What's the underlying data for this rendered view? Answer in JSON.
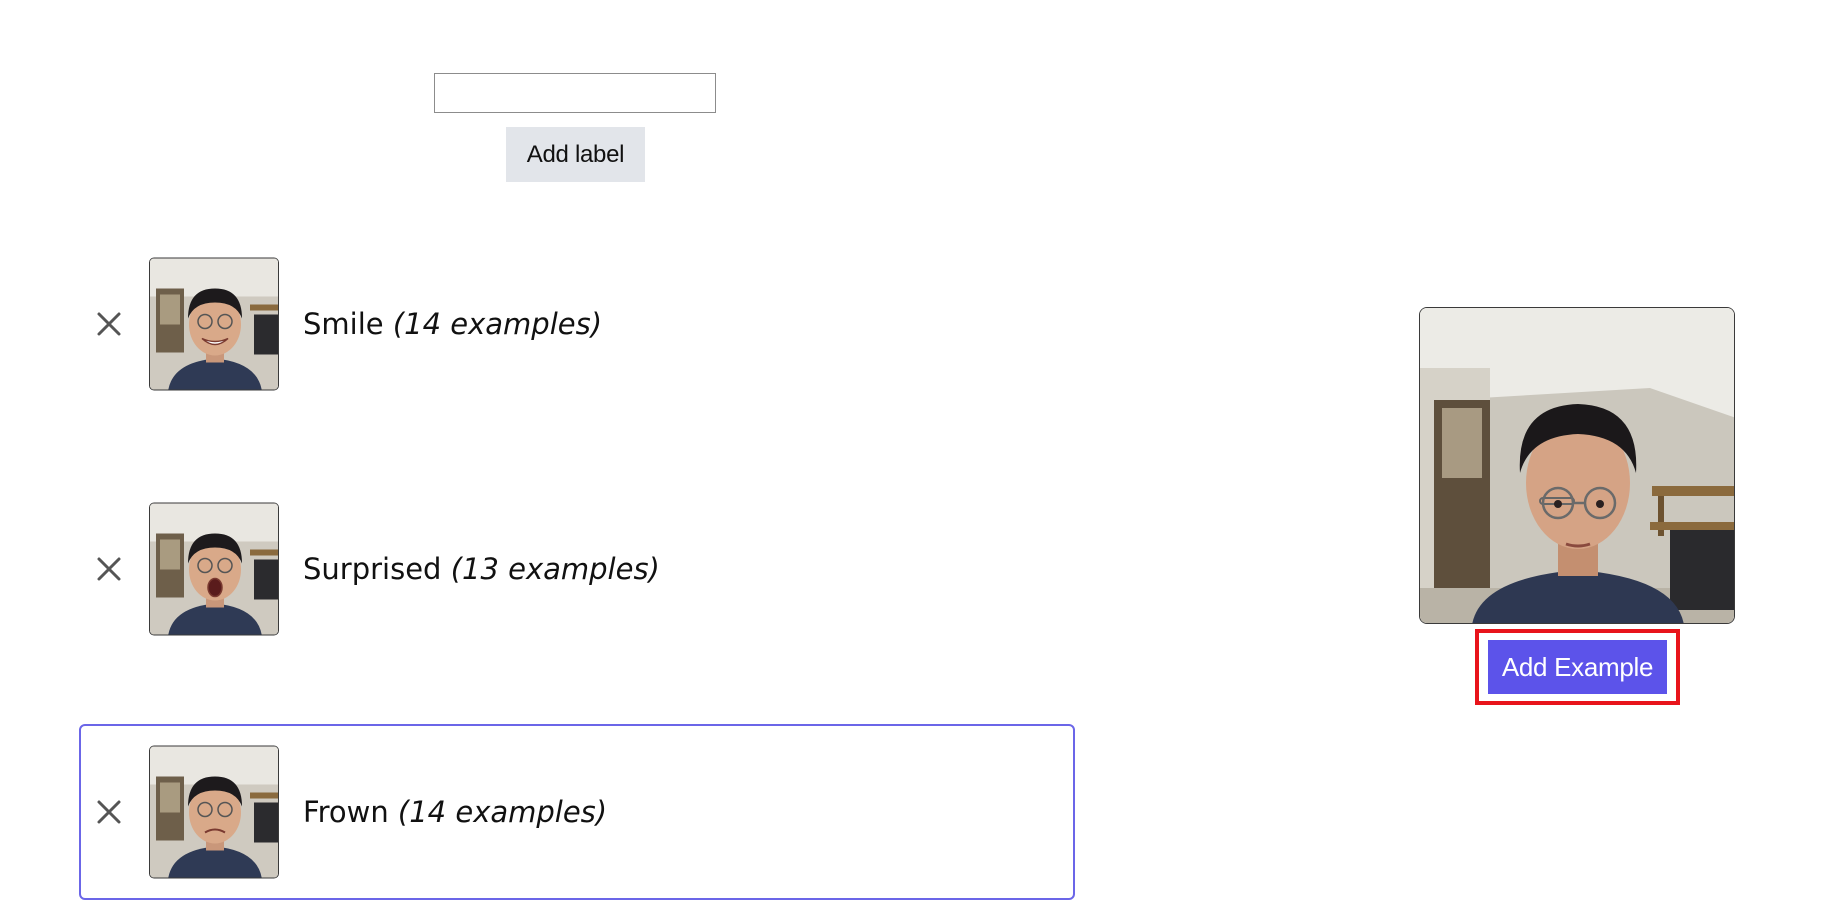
{
  "label_form": {
    "input_value": "",
    "input_placeholder": "",
    "add_label_button": "Add label"
  },
  "labels": [
    {
      "name": "Smile",
      "count_text": "(14 examples)",
      "selected": false
    },
    {
      "name": "Surprised",
      "count_text": "(13 examples)",
      "selected": false
    },
    {
      "name": "Frown",
      "count_text": "(14 examples)",
      "selected": true
    }
  ],
  "webcam": {
    "add_example_button": "Add Example"
  },
  "colors": {
    "accent": "#5c53ea",
    "selected_border": "#6b66e8",
    "highlight_border": "#e8141b",
    "secondary_button": "#e2e5ea"
  }
}
